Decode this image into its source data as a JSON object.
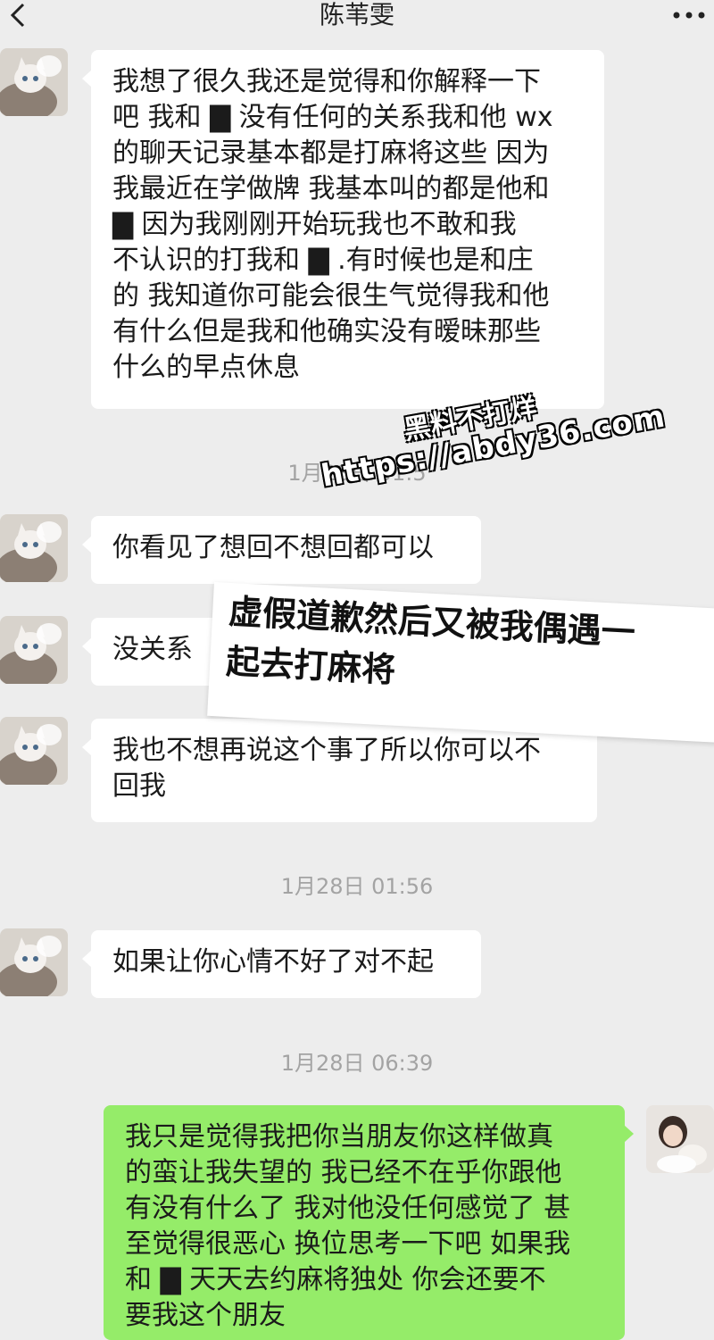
{
  "header": {
    "title": "陈苇雯",
    "back_icon": "chevron-left-icon",
    "more_icon": "more-dots-icon"
  },
  "messages": {
    "m1": {
      "sender": "contact",
      "text": "我想了很久我还是觉得和你解释一下\n吧 我和 ▇ 没有任何的关系我和他 wx\n的聊天记录基本都是打麻将这些 因为\n我最近在学做牌 我基本叫的都是他和\n ▇  因为我刚刚开始玩我也不敢和我\n不认识的打我和  ▇ .有时候也是和庄\n的 我知道你可能会很生气觉得我和他\n有什么但是我和他确实没有暧昧那些\n什么的早点休息"
    },
    "t1": "1月28日 01:5",
    "m2": {
      "sender": "contact",
      "text": "你看见了想回不想回都可以"
    },
    "m3": {
      "sender": "contact",
      "text": "没关系"
    },
    "m4": {
      "sender": "contact",
      "text": "我也不想再说这个事了所以你可以不\n回我"
    },
    "t2": "1月28日 01:56",
    "m5": {
      "sender": "contact",
      "text": "如果让你心情不好了对不起"
    },
    "t3": "1月28日 06:39",
    "m6": {
      "sender": "me",
      "text": "我只是觉得我把你当朋友你这样做真\n的蛮让我失望的 我已经不在乎你跟他\n有没有什么了 我对他没任何感觉了 甚\n至觉得很恶心 换位思考一下吧 如果我\n和 ▇ 天天去约麻将独处 你会还要不\n要我这个朋友"
    }
  },
  "overlay": {
    "caption": "虚假道歉然后又被我偶遇一\n起去打麻将"
  },
  "watermark": {
    "line1": "黑料不打烊",
    "line2": "https://abdy36.com"
  },
  "colors": {
    "background": "#ededed",
    "incoming_bubble": "#ffffff",
    "outgoing_bubble": "#95ec69",
    "timestamp": "#a3a3a3"
  }
}
